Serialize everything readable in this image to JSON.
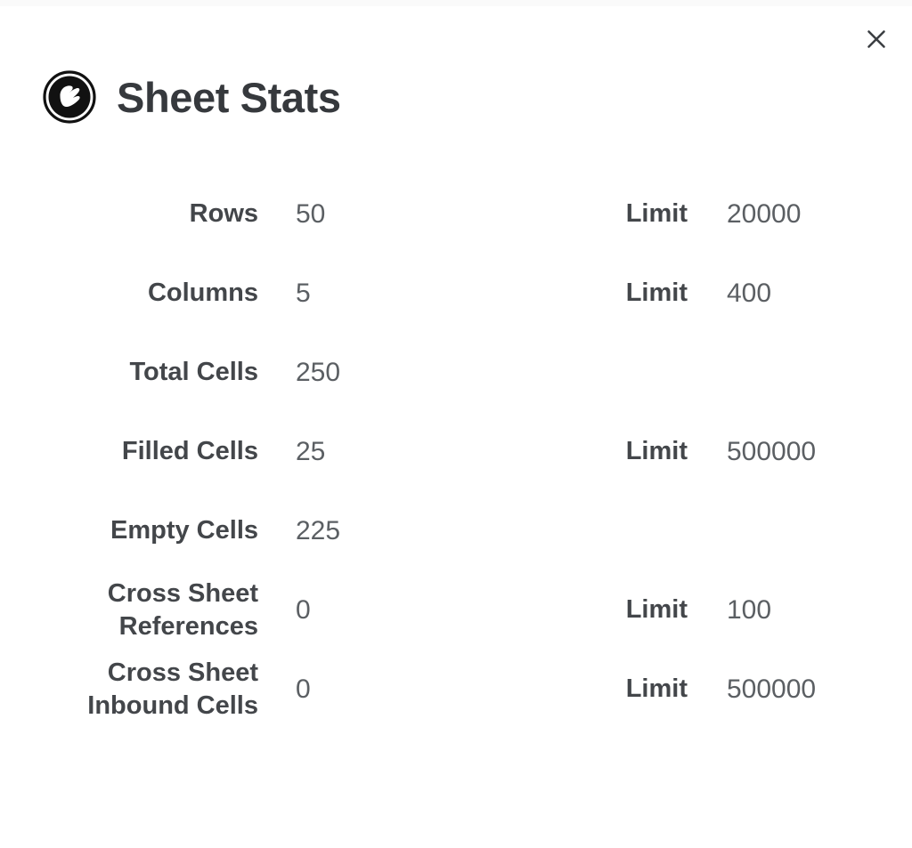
{
  "dialog": {
    "title": "Sheet Stats",
    "brand_icon": "sheet-stats-logo-icon",
    "close_icon": "close-icon",
    "close_label": "×"
  },
  "stats": {
    "rows": [
      {
        "label": "Rows",
        "value": "50",
        "limit_label": "Limit",
        "limit_value": "20000"
      },
      {
        "label": "Columns",
        "value": "5",
        "limit_label": "Limit",
        "limit_value": "400"
      },
      {
        "label": "Total Cells",
        "value": "250",
        "limit_label": "",
        "limit_value": ""
      },
      {
        "label": "Filled Cells",
        "value": "25",
        "limit_label": "Limit",
        "limit_value": "500000"
      },
      {
        "label": "Empty Cells",
        "value": "225",
        "limit_label": "",
        "limit_value": ""
      },
      {
        "label": "Cross Sheet References",
        "value": "0",
        "limit_label": "Limit",
        "limit_value": "100"
      },
      {
        "label": "Cross Sheet Inbound Cells",
        "value": "0",
        "limit_label": "Limit",
        "limit_value": "500000"
      }
    ]
  },
  "colors": {
    "background": "#ffffff",
    "top_strip": "#fafafa",
    "title_text": "#36393d",
    "label_text": "#43464a",
    "value_text": "#5b5f63",
    "close_icon": "#3c3f43"
  }
}
